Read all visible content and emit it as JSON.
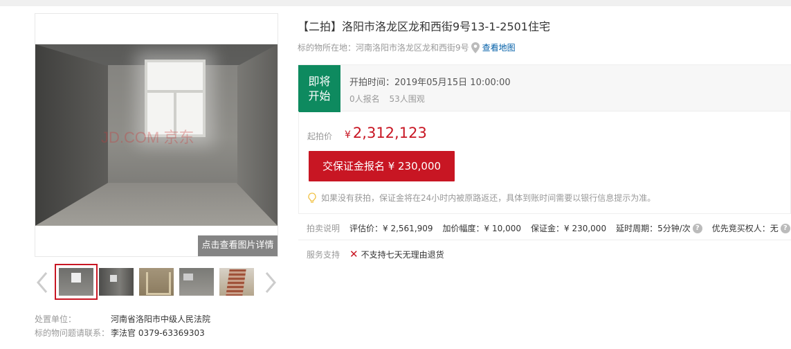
{
  "gallery": {
    "watermark": "JD.COM 京东",
    "detail_button": "点击查看图片详情",
    "thumbnails": [
      "thumb-1",
      "thumb-2",
      "thumb-3",
      "thumb-4",
      "thumb-5"
    ],
    "active_index": 0
  },
  "meta": {
    "disposer_label": "处置单位：",
    "disposer_value": "河南省洛阳市中级人民法院",
    "contact_label": "标的物问题请联系：",
    "contact_value": "李法官 0379-63369303"
  },
  "item": {
    "title": "【二拍】洛阳市洛龙区龙和西街9号13-1-2501住宅",
    "location_label": "标的物所在地：",
    "location_value": "河南洛阳市洛龙区龙和西街9号",
    "map_link": "查看地图"
  },
  "status": {
    "badge_line1": "即将",
    "badge_line2": "开始",
    "start_time": "开拍时间：2019年05月15日 10:00:00",
    "signups": "0人报名",
    "watchers": "53人围观"
  },
  "price": {
    "start_label": "起拍价",
    "currency": "¥",
    "start_price": "2,312,123",
    "deposit_button": "交保证金报名 ¥ 230,000",
    "tip": "如果没有获拍，保证金将在24小时内被原路返还，具体到账时间需要以银行信息提示为准。"
  },
  "auction_info": {
    "label": "拍卖说明",
    "appraisal": "评估价：¥ 2,561,909",
    "increment": "加价幅度：¥ 10,000",
    "deposit": "保证金：¥ 230,000",
    "extension": "延时周期：5分钟/次",
    "priority": "优先竞买权人：无"
  },
  "service": {
    "label": "服务支持",
    "value": "不支持七天无理由退货"
  },
  "colors": {
    "accent_red": "#c81623",
    "status_green": "#0e8a5f",
    "link_blue": "#005ea7"
  }
}
